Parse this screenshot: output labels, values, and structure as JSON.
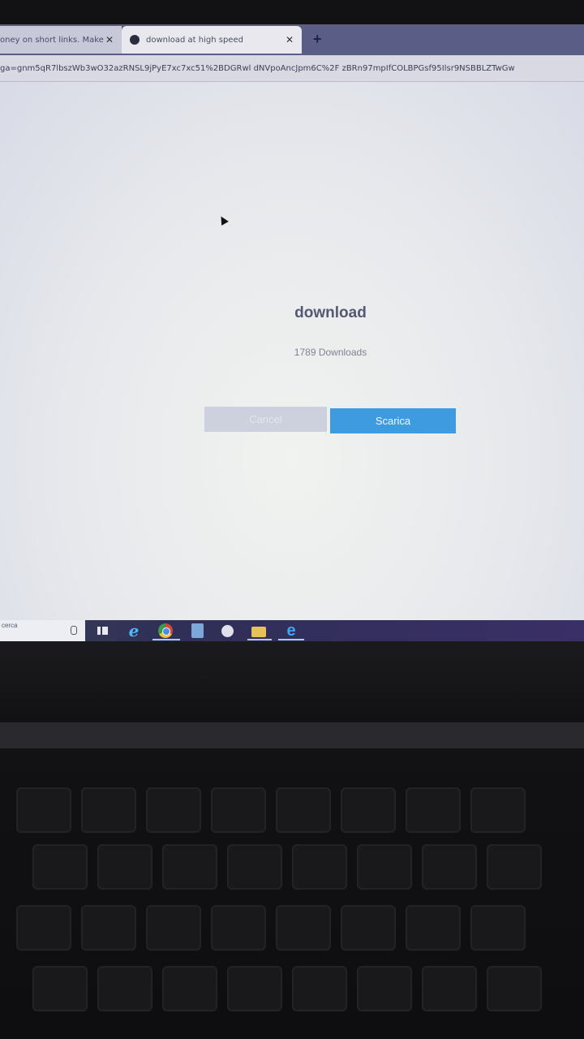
{
  "browser": {
    "tabs": [
      {
        "title": "oney on short links. Make",
        "close": "✕",
        "active": false
      },
      {
        "title": "download at high speed",
        "close": "✕",
        "active": true
      }
    ],
    "new_tab": "+",
    "url": "ga=gnm5qR7lbszWb3wO32azRNSL9jPyE7xc7xc51%2BDGRwl dNVpoAncJpm6C%2F zBRn97mpIfCOLBPGsf95Ilsr9NSBBLZTwGw"
  },
  "page": {
    "title": "download",
    "count_text": "1789 Downloads",
    "cancel_label": "Cancel",
    "download_label": "Scarica"
  },
  "taskbar": {
    "search_text": "cerca",
    "icons": [
      "task-view-icon",
      "internet-explorer-icon",
      "chrome-icon",
      "document-icon",
      "app-icon",
      "file-explorer-icon",
      "edge-icon"
    ]
  },
  "colors": {
    "accent_button": "#3f9be0",
    "disabled_button": "#cdd0dd",
    "tabstrip": "#5a5e86"
  }
}
